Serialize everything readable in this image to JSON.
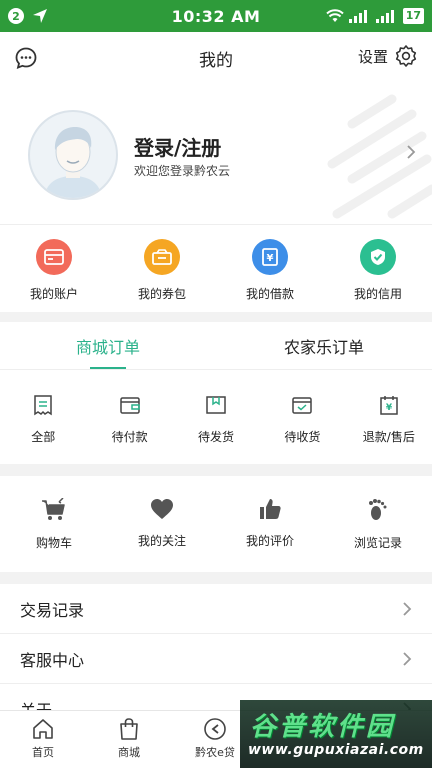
{
  "status_bar": {
    "notification_count": "2",
    "time": "10:32 AM",
    "battery": "17"
  },
  "header": {
    "title": "我的",
    "settings_label": "设置"
  },
  "profile": {
    "login_title": "登录/注册",
    "welcome_text": "欢迎您登录黔农云"
  },
  "quick_links": [
    {
      "label": "我的账户",
      "icon": "wallet-icon",
      "color": "#f26a5a"
    },
    {
      "label": "我的券包",
      "icon": "coupon-bag-icon",
      "color": "#f5a623"
    },
    {
      "label": "我的借款",
      "icon": "loan-icon",
      "color": "#3d8ee8"
    },
    {
      "label": "我的信用",
      "icon": "credit-shield-icon",
      "color": "#2bbf91"
    }
  ],
  "orders": {
    "tabs": [
      "商城订单",
      "农家乐订单"
    ],
    "active_tab": "商城订单",
    "items": [
      {
        "label": "全部",
        "icon": "receipt-icon"
      },
      {
        "label": "待付款",
        "icon": "wallet-outline-icon"
      },
      {
        "label": "待发货",
        "icon": "package-icon"
      },
      {
        "label": "待收货",
        "icon": "delivery-icon"
      },
      {
        "label": "退款/售后",
        "icon": "refund-icon"
      }
    ]
  },
  "tools": [
    {
      "label": "购物车",
      "icon": "cart-icon"
    },
    {
      "label": "我的关注",
      "icon": "heart-icon"
    },
    {
      "label": "我的评价",
      "icon": "thumbs-up-icon"
    },
    {
      "label": "浏览记录",
      "icon": "footprint-icon"
    }
  ],
  "menu_list": [
    "交易记录",
    "客服中心",
    "关于"
  ],
  "bottom_nav": [
    {
      "label": "首页",
      "icon": "home-icon"
    },
    {
      "label": "商城",
      "icon": "shopping-bag-icon"
    },
    {
      "label": "黔农e贷",
      "icon": "loan-logo-icon"
    }
  ],
  "watermark": {
    "main": "谷普软件园",
    "url": "www.gupuxiazai.com"
  },
  "colors": {
    "status_bar": "#2e9b3a",
    "accent": "#2bb28b"
  }
}
